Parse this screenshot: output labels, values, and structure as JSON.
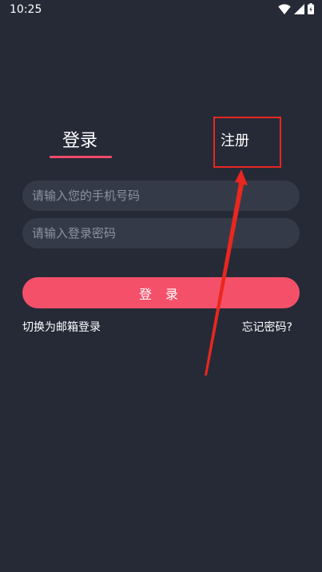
{
  "status_bar": {
    "time": "10:25",
    "icons": [
      "wifi-icon",
      "signal-icon",
      "battery-icon"
    ]
  },
  "tabs": {
    "login_label": "登录",
    "register_label": "注册",
    "active_color": "#f04b67"
  },
  "form": {
    "phone_placeholder": "请输入您的手机号码",
    "password_placeholder": "请输入登录密码",
    "submit_label": "登 录"
  },
  "links": {
    "switch_label": "切换为邮箱登录",
    "forgot_label": "忘记密码?"
  },
  "annotation": {
    "color": "#e8271f"
  }
}
